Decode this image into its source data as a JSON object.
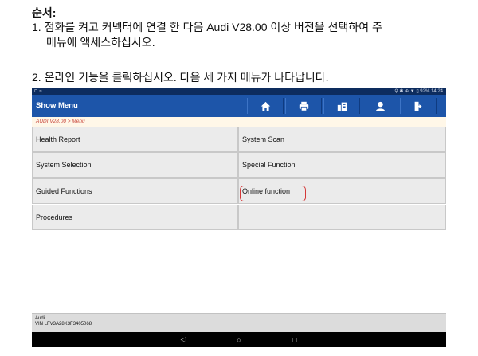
{
  "doc": {
    "heading": "순서:",
    "step1_line1": "1.  점화를 켜고 커넥터에 연결 한 다음 Audi V28.00 이상 버전을 선택하여 주",
    "step1_line2": "메뉴에 액세스하십시오.",
    "step2": "2. 온라인 기능을 클릭하십시오. 다음 세 가지 메뉴가 나타납니다."
  },
  "device": {
    "status_left": "⊓ ≈",
    "status_right": "⚲ ✱ ⊕ ▼ ▯ 92%  14:24",
    "title": "Show Menu",
    "toolbar_icons": [
      "home-icon",
      "printer-icon",
      "vehicle-info-icon",
      "user-icon",
      "exit-icon"
    ],
    "breadcrumb": "AUDI V28.00 > Menu",
    "menu": {
      "health_report": "Health Report",
      "system_scan": "System Scan",
      "system_selection": "System Selection",
      "special_function": "Special Function",
      "guided_functions": "Guided Functions",
      "online_function": "Online function",
      "procedures": "Procedures"
    },
    "footer_line1": "Audi",
    "footer_line2": "VIN LFV3A28K3F3405068",
    "nav": {
      "back": "◁",
      "home": "○",
      "recents": "□"
    },
    "colors": {
      "titlebar": "#1d55a9",
      "statusbar": "#0d2c5e",
      "highlight": "#d43838"
    }
  }
}
